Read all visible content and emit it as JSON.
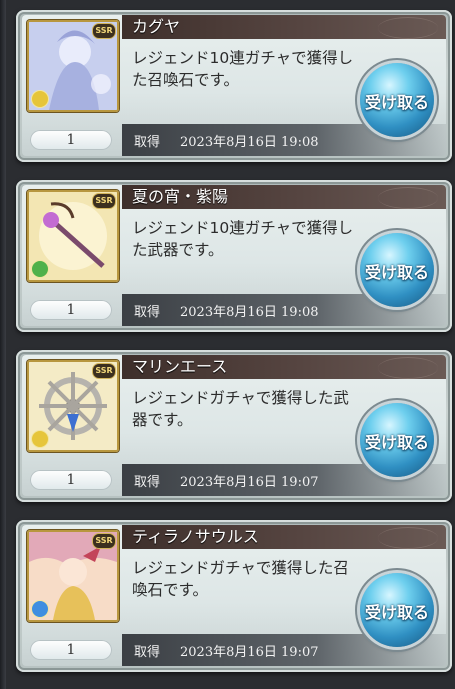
{
  "items": [
    {
      "name": "カグヤ",
      "description": "レジェンド10連ガチャで獲得した召喚石です。",
      "quantity": "1",
      "obtained_label": "取得",
      "obtained_date": "2023年8月16日 19:08",
      "button_label": "受け取る",
      "rarity": "SSR",
      "element_color": "#e6c53a",
      "art_colors": [
        "#cfd6f2",
        "#9aa6d8"
      ]
    },
    {
      "name": "夏の宵・紫陽",
      "description": "レジェンド10連ガチャで獲得した武器です。",
      "quantity": "1",
      "obtained_label": "取得",
      "obtained_date": "2023年8月16日 19:08",
      "button_label": "受け取る",
      "rarity": "SSR",
      "element_color": "#4fb14a",
      "art_colors": [
        "#f0e1a6",
        "#c9a85a"
      ]
    },
    {
      "name": "マリンエース",
      "description": "レジェンドガチャで獲得した武器です。",
      "quantity": "1",
      "obtained_label": "取得",
      "obtained_date": "2023年8月16日 19:07",
      "button_label": "受け取る",
      "rarity": "SSR",
      "element_color": "#e6c53a",
      "art_colors": [
        "#f4e9bd",
        "#d8bf78"
      ]
    },
    {
      "name": "ティラノサウルス",
      "description": "レジェンドガチャで獲得した召喚石です。",
      "quantity": "1",
      "obtained_label": "取得",
      "obtained_date": "2023年8月16日 19:07",
      "button_label": "受け取る",
      "rarity": "SSR",
      "element_color": "#3f8ee0",
      "art_colors": [
        "#f6d9c4",
        "#d98aa0"
      ]
    }
  ]
}
